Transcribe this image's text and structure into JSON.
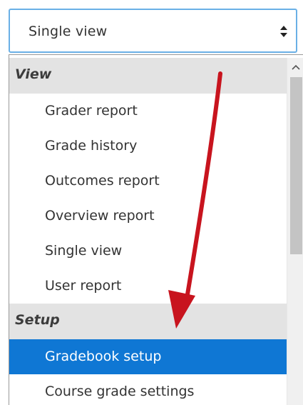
{
  "select": {
    "value": "Single view",
    "arrows_icon": "up-down-arrows-icon"
  },
  "dropdown": {
    "groups": [
      {
        "label": "View",
        "options": [
          "Grader report",
          "Grade history",
          "Outcomes report",
          "Overview report",
          "Single view",
          "User report"
        ]
      },
      {
        "label": "Setup",
        "options": [
          "Gradebook setup",
          "Course grade settings"
        ]
      }
    ],
    "selected": "Gradebook setup"
  },
  "annotation": {
    "arrow_color": "#c8141e"
  },
  "colors": {
    "focus_border": "#6ab0e6",
    "selected_bg": "#0f77d4",
    "group_header_bg": "#e3e3e3"
  }
}
